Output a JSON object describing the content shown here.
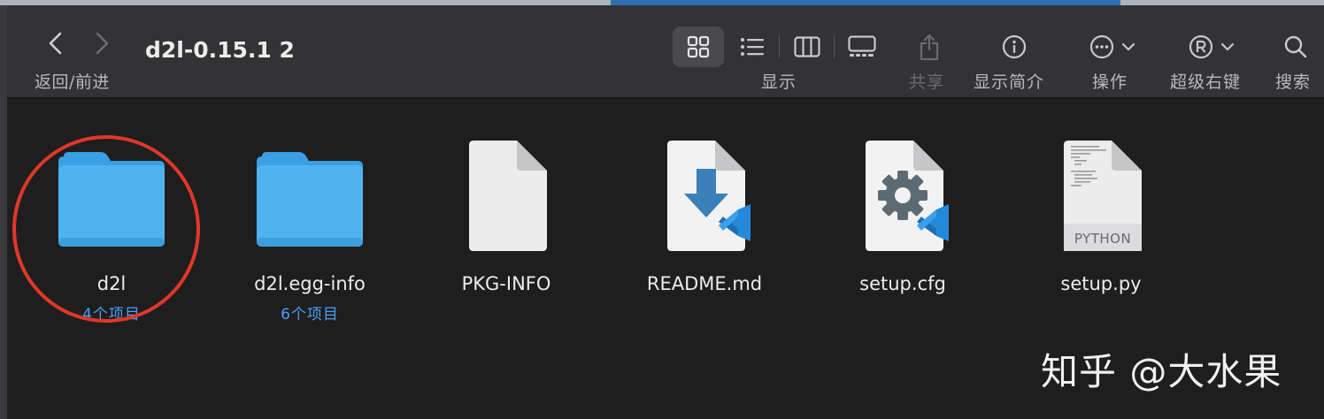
{
  "window": {
    "title": "d2l-0.15.1 2"
  },
  "toolbar": {
    "nav_label": "返回/前进",
    "view_label": "显示",
    "share_label": "共享",
    "info_label": "显示简介",
    "action_label": "操作",
    "super_rightclick_label": "超级右键",
    "search_label": "搜索"
  },
  "items": [
    {
      "name": "d2l",
      "subtitle": "4个项目",
      "kind": "folder"
    },
    {
      "name": "d2l.egg-info",
      "subtitle": "6个项目",
      "kind": "folder"
    },
    {
      "name": "PKG-INFO",
      "kind": "document"
    },
    {
      "name": "README.md",
      "kind": "markdown-vscode"
    },
    {
      "name": "setup.cfg",
      "kind": "config-vscode"
    },
    {
      "name": "setup.py",
      "kind": "python",
      "badge": "PYTHON"
    }
  ],
  "watermark": "知乎 @大水果",
  "colors": {
    "accent": "#4d9ef5",
    "highlight": "#e0372b",
    "folder": "#4fb3f2"
  }
}
